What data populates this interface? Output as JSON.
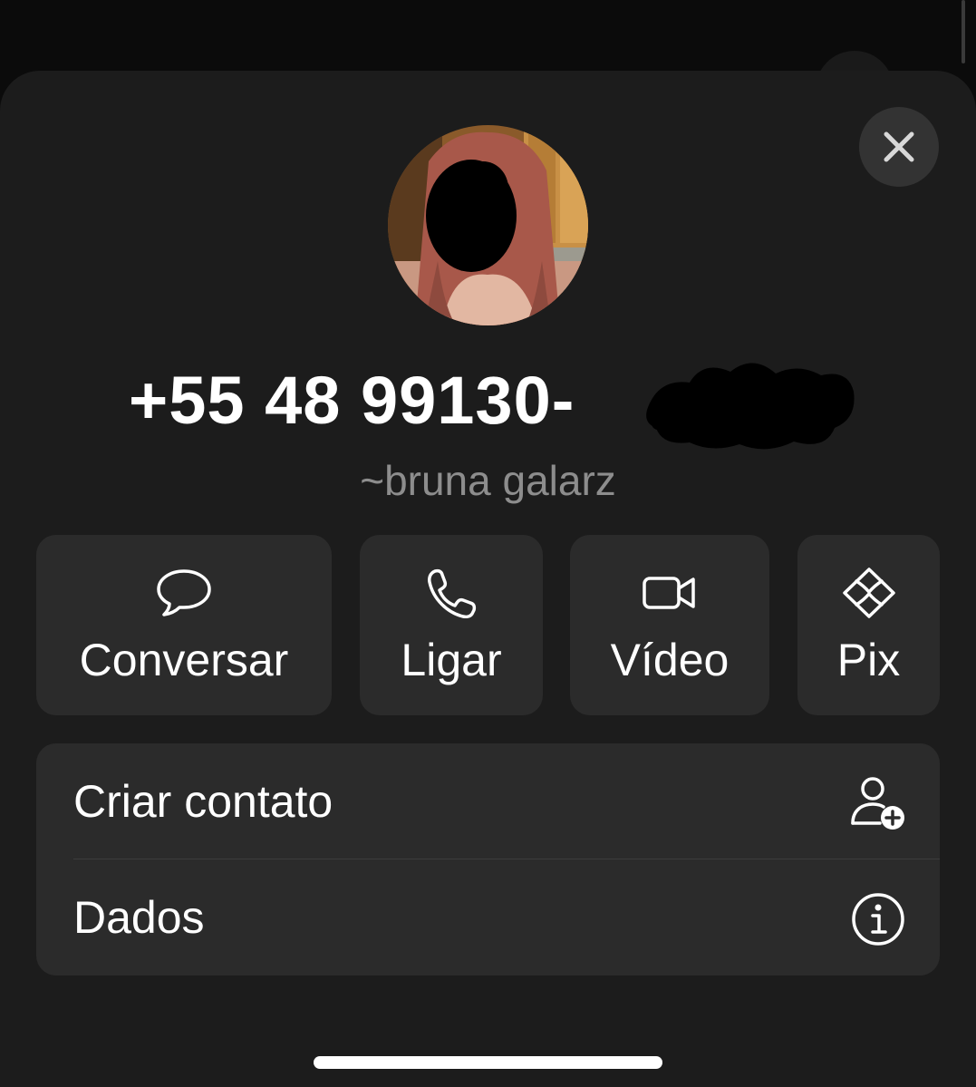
{
  "contact": {
    "phone_visible": "+55 48 99130-",
    "push_name": "~bruna galarz"
  },
  "actions": [
    {
      "label": "Conversar",
      "icon": "chat-bubble-icon"
    },
    {
      "label": "Ligar",
      "icon": "phone-icon"
    },
    {
      "label": "Vídeo",
      "icon": "video-camera-icon"
    },
    {
      "label": "Pix",
      "icon": "pix-icon"
    }
  ],
  "menu": [
    {
      "label": "Criar contato",
      "icon": "add-person-icon"
    },
    {
      "label": "Dados",
      "icon": "info-icon"
    }
  ],
  "colors": {
    "background": "#0b0b0b",
    "sheet": "#1c1c1c",
    "button": "#2b2b2b",
    "close_button": "#333333",
    "text_primary": "#ffffff",
    "text_secondary": "#8d8d8d"
  }
}
